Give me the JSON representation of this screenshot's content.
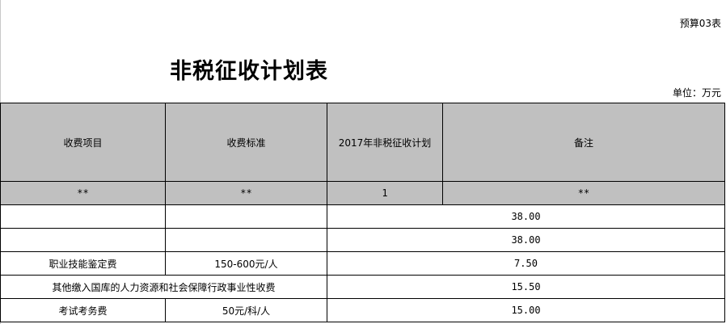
{
  "header": {
    "table_code": "预算03表",
    "title": "非税征收计划表",
    "unit": "单位：万元"
  },
  "table": {
    "columns": [
      "收费项目",
      "收费标准",
      "2017年非税征收计划",
      "备注"
    ],
    "subheader": [
      "**",
      "**",
      "1",
      "**"
    ],
    "rows": [
      {
        "item": "",
        "standard": "",
        "amount": "38.00"
      },
      {
        "item": "",
        "standard": "",
        "amount": "38.00"
      },
      {
        "item": "职业技能鉴定费",
        "standard": "150-600元/人",
        "amount": "7.50"
      },
      {
        "item": "其他缴入国库的人力资源和社会保障行政事业性收费",
        "standard": "",
        "amount": "15.50"
      },
      {
        "item": "考试考务费",
        "standard": "50元/科/人",
        "amount": "15.00"
      }
    ]
  }
}
